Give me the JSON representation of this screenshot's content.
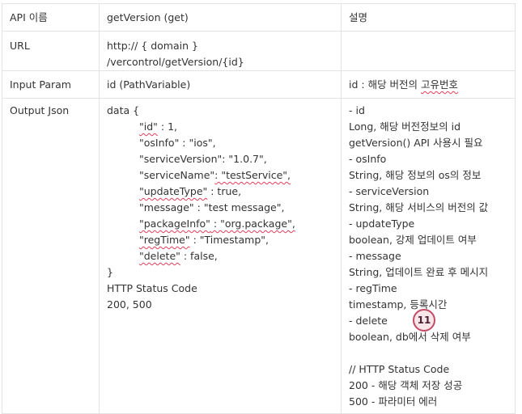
{
  "table": {
    "header": {
      "label": "API 이름",
      "value": "getVersion (get)",
      "desc": "설명"
    },
    "url": {
      "label": "URL",
      "value": "http:// { domain } /vercontrol/getVersion/{id}",
      "desc": ""
    },
    "input": {
      "label": "Input Param",
      "value": "id (PathVariable)",
      "desc_prefix": "id : 해당 버전의 ",
      "desc_underlined": "고유번호"
    },
    "output": {
      "label": "Output Json",
      "code_open": "data {",
      "fields": [
        {
          "key": "\"id\"",
          "rest": " : 1,",
          "squiggle": true
        },
        {
          "key": "\"osInfo\"",
          "rest": " :  \"ios\",",
          "squiggle": false
        },
        {
          "key": "\"serviceVersion\"",
          "rest": ": \"1.0.7\",",
          "squiggle": false
        },
        {
          "key": "\"serviceName\"",
          "rest": ": \"testService\",",
          "squiggle": false,
          "value_squiggle": true
        },
        {
          "key": "\"updateType\"",
          "rest": " : true,",
          "squiggle": true
        },
        {
          "key": "\"message\"",
          "rest": " : \"test message\",",
          "squiggle": false
        },
        {
          "key": "\"packageInfo\"",
          "rest": " : \"org.package\",",
          "squiggle": true,
          "value_squiggle": true
        },
        {
          "key": "\"regTime\"",
          "rest": " : \"Timestamp\",",
          "squiggle": true
        },
        {
          "key": "\"delete\"",
          "rest": " : false,",
          "squiggle": true
        }
      ],
      "code_close": "}",
      "status_title": "HTTP Status Code",
      "status_values": "200, 500",
      "desc_lines": [
        "- id",
        "Long, 해당 버전정보의 id",
        "getVersion() API 사용시 필요",
        "- osInfo",
        "String, 해당 정보의 os의 정보",
        "- serviceVersion",
        "String, 해당 서비스의 버전의 값",
        "- updateType",
        "boolean, 강제 업데이트 여부",
        "- message",
        "String, 업데이트 완료 후 메시지",
        "- regTime",
        "timestamp, 등록시간",
        "- delete",
        "boolean, db에서 삭제 여부",
        "",
        "// HTTP Status Code",
        "200 - 해당 객체 저장 성공",
        "500 - 파라미터 에러"
      ]
    }
  },
  "badge": {
    "count": "11"
  }
}
